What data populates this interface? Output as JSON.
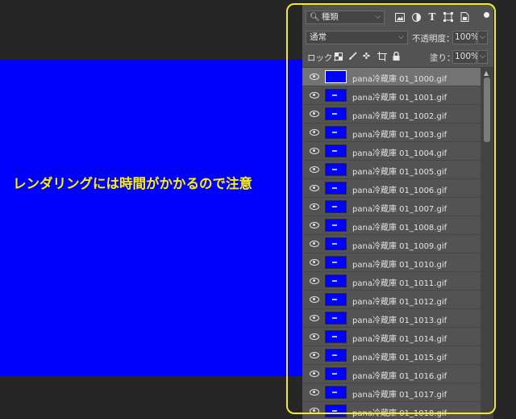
{
  "canvas": {
    "note": "レンダリングには時間がかかるので注意",
    "background_color": "#0000fe",
    "note_color": "#fff200"
  },
  "layers_panel": {
    "filter": {
      "icon": "search-icon",
      "value": "種類"
    },
    "filter_icons": [
      "image-filter-icon",
      "adjustment-filter-icon",
      "type-filter-icon",
      "shape-filter-icon",
      "smart-object-filter-icon"
    ],
    "blend_mode": "通常",
    "opacity_label": "不透明度：",
    "opacity_value": "100%",
    "lock_label": "ロック：",
    "lock_icons": [
      "lock-transparent-icon",
      "lock-paint-icon",
      "lock-position-icon",
      "lock-artboard-icon",
      "lock-all-icon"
    ],
    "fill_label": "塗り：",
    "fill_value": "100%",
    "layers": [
      {
        "name": "pana冷蔵庫 01_1000.gif",
        "selected": true
      },
      {
        "name": "pana冷蔵庫 01_1001.gif"
      },
      {
        "name": "pana冷蔵庫 01_1002.gif"
      },
      {
        "name": "pana冷蔵庫 01_1003.gif"
      },
      {
        "name": "pana冷蔵庫 01_1004.gif"
      },
      {
        "name": "pana冷蔵庫 01_1005.gif"
      },
      {
        "name": "pana冷蔵庫 01_1006.gif"
      },
      {
        "name": "pana冷蔵庫 01_1007.gif"
      },
      {
        "name": "pana冷蔵庫 01_1008.gif"
      },
      {
        "name": "pana冷蔵庫 01_1009.gif"
      },
      {
        "name": "pana冷蔵庫 01_1010.gif"
      },
      {
        "name": "pana冷蔵庫 01_1011.gif"
      },
      {
        "name": "pana冷蔵庫 01_1012.gif"
      },
      {
        "name": "pana冷蔵庫 01_1013.gif"
      },
      {
        "name": "pana冷蔵庫 01_1014.gif"
      },
      {
        "name": "pana冷蔵庫 01_1015.gif"
      },
      {
        "name": "pana冷蔵庫 01_1016.gif"
      },
      {
        "name": "pana冷蔵庫 01_1017.gif"
      },
      {
        "name": "pana冷蔵庫 01_1018.gif"
      }
    ],
    "highlight_color": "#f4ea2a"
  }
}
